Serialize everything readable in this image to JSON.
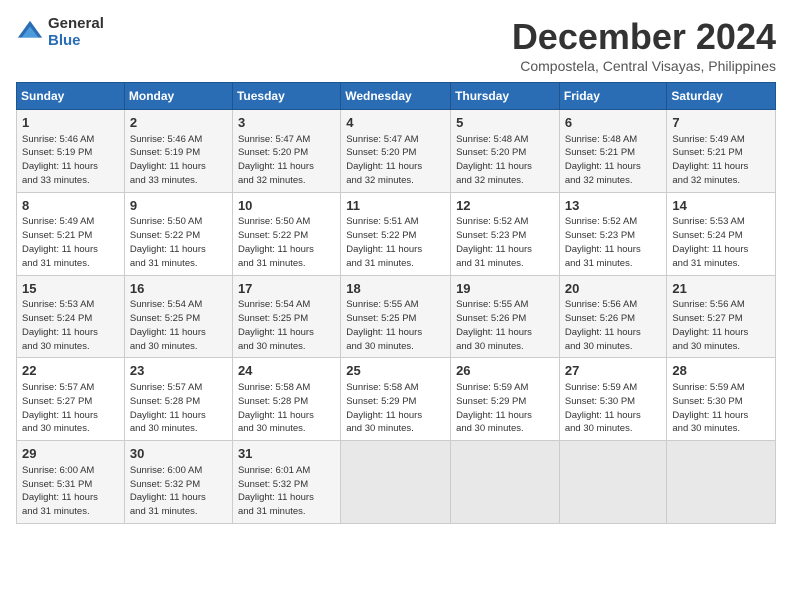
{
  "header": {
    "logo_general": "General",
    "logo_blue": "Blue",
    "month": "December 2024",
    "location": "Compostela, Central Visayas, Philippines"
  },
  "weekdays": [
    "Sunday",
    "Monday",
    "Tuesday",
    "Wednesday",
    "Thursday",
    "Friday",
    "Saturday"
  ],
  "weeks": [
    [
      {
        "day": "1",
        "info": "Sunrise: 5:46 AM\nSunset: 5:19 PM\nDaylight: 11 hours\nand 33 minutes."
      },
      {
        "day": "2",
        "info": "Sunrise: 5:46 AM\nSunset: 5:19 PM\nDaylight: 11 hours\nand 33 minutes."
      },
      {
        "day": "3",
        "info": "Sunrise: 5:47 AM\nSunset: 5:20 PM\nDaylight: 11 hours\nand 32 minutes."
      },
      {
        "day": "4",
        "info": "Sunrise: 5:47 AM\nSunset: 5:20 PM\nDaylight: 11 hours\nand 32 minutes."
      },
      {
        "day": "5",
        "info": "Sunrise: 5:48 AM\nSunset: 5:20 PM\nDaylight: 11 hours\nand 32 minutes."
      },
      {
        "day": "6",
        "info": "Sunrise: 5:48 AM\nSunset: 5:21 PM\nDaylight: 11 hours\nand 32 minutes."
      },
      {
        "day": "7",
        "info": "Sunrise: 5:49 AM\nSunset: 5:21 PM\nDaylight: 11 hours\nand 32 minutes."
      }
    ],
    [
      {
        "day": "8",
        "info": "Sunrise: 5:49 AM\nSunset: 5:21 PM\nDaylight: 11 hours\nand 31 minutes."
      },
      {
        "day": "9",
        "info": "Sunrise: 5:50 AM\nSunset: 5:22 PM\nDaylight: 11 hours\nand 31 minutes."
      },
      {
        "day": "10",
        "info": "Sunrise: 5:50 AM\nSunset: 5:22 PM\nDaylight: 11 hours\nand 31 minutes."
      },
      {
        "day": "11",
        "info": "Sunrise: 5:51 AM\nSunset: 5:22 PM\nDaylight: 11 hours\nand 31 minutes."
      },
      {
        "day": "12",
        "info": "Sunrise: 5:52 AM\nSunset: 5:23 PM\nDaylight: 11 hours\nand 31 minutes."
      },
      {
        "day": "13",
        "info": "Sunrise: 5:52 AM\nSunset: 5:23 PM\nDaylight: 11 hours\nand 31 minutes."
      },
      {
        "day": "14",
        "info": "Sunrise: 5:53 AM\nSunset: 5:24 PM\nDaylight: 11 hours\nand 31 minutes."
      }
    ],
    [
      {
        "day": "15",
        "info": "Sunrise: 5:53 AM\nSunset: 5:24 PM\nDaylight: 11 hours\nand 30 minutes."
      },
      {
        "day": "16",
        "info": "Sunrise: 5:54 AM\nSunset: 5:25 PM\nDaylight: 11 hours\nand 30 minutes."
      },
      {
        "day": "17",
        "info": "Sunrise: 5:54 AM\nSunset: 5:25 PM\nDaylight: 11 hours\nand 30 minutes."
      },
      {
        "day": "18",
        "info": "Sunrise: 5:55 AM\nSunset: 5:25 PM\nDaylight: 11 hours\nand 30 minutes."
      },
      {
        "day": "19",
        "info": "Sunrise: 5:55 AM\nSunset: 5:26 PM\nDaylight: 11 hours\nand 30 minutes."
      },
      {
        "day": "20",
        "info": "Sunrise: 5:56 AM\nSunset: 5:26 PM\nDaylight: 11 hours\nand 30 minutes."
      },
      {
        "day": "21",
        "info": "Sunrise: 5:56 AM\nSunset: 5:27 PM\nDaylight: 11 hours\nand 30 minutes."
      }
    ],
    [
      {
        "day": "22",
        "info": "Sunrise: 5:57 AM\nSunset: 5:27 PM\nDaylight: 11 hours\nand 30 minutes."
      },
      {
        "day": "23",
        "info": "Sunrise: 5:57 AM\nSunset: 5:28 PM\nDaylight: 11 hours\nand 30 minutes."
      },
      {
        "day": "24",
        "info": "Sunrise: 5:58 AM\nSunset: 5:28 PM\nDaylight: 11 hours\nand 30 minutes."
      },
      {
        "day": "25",
        "info": "Sunrise: 5:58 AM\nSunset: 5:29 PM\nDaylight: 11 hours\nand 30 minutes."
      },
      {
        "day": "26",
        "info": "Sunrise: 5:59 AM\nSunset: 5:29 PM\nDaylight: 11 hours\nand 30 minutes."
      },
      {
        "day": "27",
        "info": "Sunrise: 5:59 AM\nSunset: 5:30 PM\nDaylight: 11 hours\nand 30 minutes."
      },
      {
        "day": "28",
        "info": "Sunrise: 5:59 AM\nSunset: 5:30 PM\nDaylight: 11 hours\nand 30 minutes."
      }
    ],
    [
      {
        "day": "29",
        "info": "Sunrise: 6:00 AM\nSunset: 5:31 PM\nDaylight: 11 hours\nand 31 minutes."
      },
      {
        "day": "30",
        "info": "Sunrise: 6:00 AM\nSunset: 5:32 PM\nDaylight: 11 hours\nand 31 minutes."
      },
      {
        "day": "31",
        "info": "Sunrise: 6:01 AM\nSunset: 5:32 PM\nDaylight: 11 hours\nand 31 minutes."
      },
      {
        "day": "",
        "info": ""
      },
      {
        "day": "",
        "info": ""
      },
      {
        "day": "",
        "info": ""
      },
      {
        "day": "",
        "info": ""
      }
    ]
  ]
}
